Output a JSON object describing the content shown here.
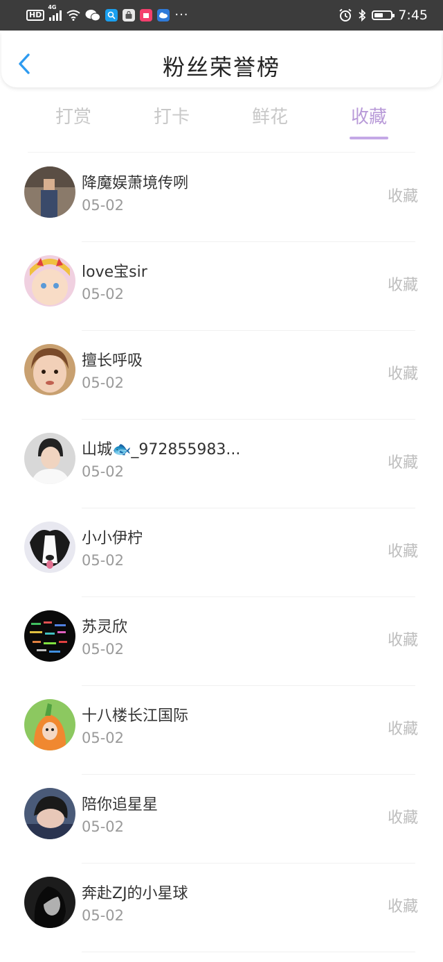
{
  "status_bar": {
    "hd": "HD",
    "network": "4G",
    "dots": "···",
    "time": "7:45",
    "icons": [
      "hd-icon",
      "signal-icon",
      "wifi-icon",
      "wechat-icon",
      "search-app-icon",
      "bag-app-icon",
      "shop-app-icon",
      "weather-app-icon",
      "more-icon",
      "alarm-icon",
      "bluetooth-icon",
      "battery-icon"
    ]
  },
  "header": {
    "title": "粉丝荣誉榜",
    "back_icon": "chevron-left-icon",
    "accent": "#2e9bf0"
  },
  "tabs": [
    {
      "label": "打赏"
    },
    {
      "label": "打卡"
    },
    {
      "label": "鲜花"
    },
    {
      "label": "收藏"
    }
  ],
  "active_tab": "收藏",
  "accent_color": "#b89ad8",
  "list": [
    {
      "name": "降魔娱萧境传咧",
      "date": "05-02",
      "action": "收藏"
    },
    {
      "name": "love宝sir",
      "date": "05-02",
      "action": "收藏"
    },
    {
      "name": "擅长呼吸",
      "date": "05-02",
      "action": "收藏"
    },
    {
      "name": "山城🐟_972855983...",
      "date": "05-02",
      "action": "收藏"
    },
    {
      "name": "小小伊柠",
      "date": "05-02",
      "action": "收藏"
    },
    {
      "name": "苏灵欣",
      "date": "05-02",
      "action": "收藏"
    },
    {
      "name": "十八楼长江国际",
      "date": "05-02",
      "action": "收藏"
    },
    {
      "name": "陪你追星星",
      "date": "05-02",
      "action": "收藏"
    },
    {
      "name": "奔赴ZJ的小星球",
      "date": "05-02",
      "action": "收藏"
    }
  ]
}
